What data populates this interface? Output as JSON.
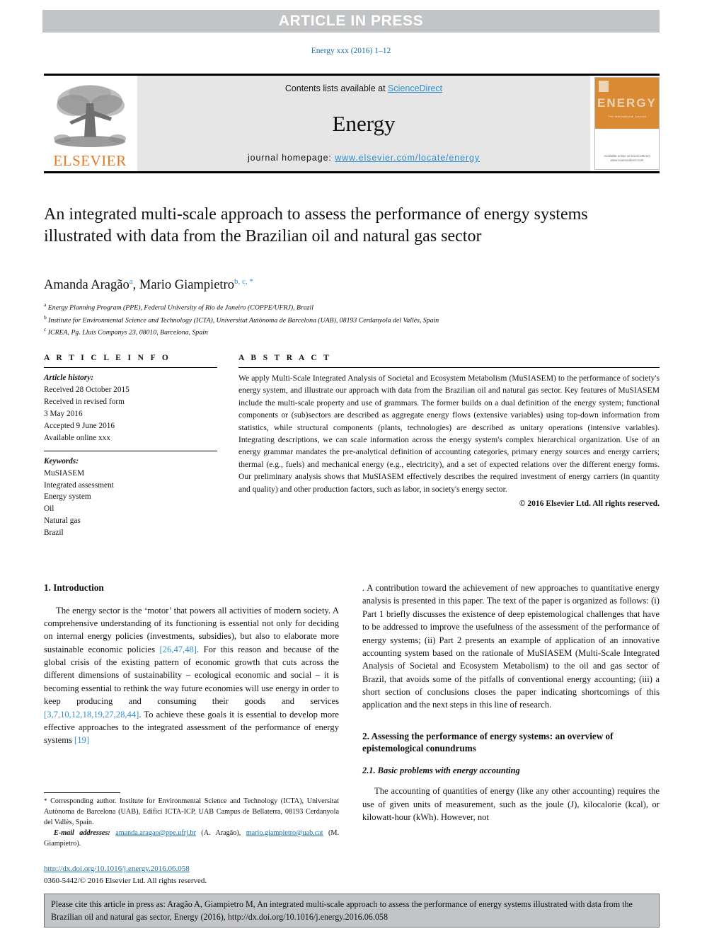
{
  "banner": {
    "label": "ARTICLE IN PRESS"
  },
  "running_head": "Energy xxx (2016) 1–12",
  "masthead": {
    "contents_prefix": "Contents lists available at ",
    "sciencedirect": "ScienceDirect",
    "journal_name": "Energy",
    "homepage_prefix": "journal homepage: ",
    "homepage_url": "www.elsevier.com/locate/energy",
    "publisher_logo_text": "ELSEVIER",
    "cover": {
      "title": "ENERGY",
      "subtitle": "The International Journal",
      "footer": "Available online at\nScienceDirect\nwww.sciencedirect.com"
    },
    "accent_link_color": "#2e8fd0",
    "elsevier_orange": "#e87722"
  },
  "article": {
    "title": "An integrated multi-scale approach to assess the performance of energy systems illustrated with data from the Brazilian oil and natural gas sector",
    "authors": [
      {
        "name": "Amanda Aragão",
        "marks": "a"
      },
      {
        "name": "Mario Giampietro",
        "marks": "b, c, *"
      }
    ],
    "affiliations": [
      {
        "mark": "a",
        "text": "Energy Planning Program (PPE), Federal University of Rio de Janeiro (COPPE/UFRJ), Brazil"
      },
      {
        "mark": "b",
        "text": "Institute for Environmental Science and Technology (ICTA), Universitat Autònoma de Barcelona (UAB), 08193 Cerdanyola del Vallès, Spain"
      },
      {
        "mark": "c",
        "text": "ICREA, Pg. Lluís Companys 23, 08010, Barcelona, Spain"
      }
    ]
  },
  "article_info": {
    "heading": "A R T I C L E  I N F O",
    "history_label": "Article history:",
    "history_lines": [
      "Received 28 October 2015",
      "Received in revised form",
      "3 May 2016",
      "Accepted 9 June 2016",
      "Available online xxx"
    ],
    "keywords_label": "Keywords:",
    "keywords": [
      "MuSIASEM",
      "Integrated assessment",
      "Energy system",
      "Oil",
      "Natural gas",
      "Brazil"
    ]
  },
  "abstract": {
    "heading": "A B S T R A C T",
    "text": "We apply Multi-Scale Integrated Analysis of Societal and Ecosystem Metabolism (MuSIASEM) to the performance of society's energy system, and illustrate our approach with data from the Brazilian oil and natural gas sector. Key features of MuSIASEM include the multi-scale property and use of grammars. The former builds on a dual definition of the energy system; functional components or (sub)sectors are described as aggregate energy flows (extensive variables) using top-down information from statistics, while structural components (plants, technologies) are described as unitary operations (intensive variables). Integrating descriptions, we can scale information across the energy system's complex hierarchical organization. Use of an energy grammar mandates the pre-analytical definition of accounting categories, primary energy sources and energy carriers; thermal (e.g., fuels) and mechanical energy (e.g., electricity), and a set of expected relations over the different energy forms. Our preliminary analysis shows that MuSIASEM effectively describes the required investment of energy carriers (in quantity and quality) and other production factors, such as labor, in society's energy sector.",
    "copyright": "© 2016 Elsevier Ltd. All rights reserved."
  },
  "body": {
    "section1_heading": "1. Introduction",
    "p1_a": "The energy sector is the ‘motor’ that powers all activities of modern society. A comprehensive understanding of its functioning is essential not only for deciding on internal energy policies (investments, subsidies), but also to elaborate more sustainable economic policies ",
    "p1_ref1": "[26,47,48]",
    "p1_b": ". For this reason and because of the global crisis of the existing pattern of economic growth that cuts across the different dimensions of sustainability – ecological economic and social – it is becoming essential to rethink the way future economies will use energy in order to keep producing and consuming their goods and services ",
    "p1_ref2": "[3,7,10,12,18,19,27,28,44]",
    "p1_c": ". To achieve these goals it is essential to develop more effective approaches to the integrated assessment of the performance of energy systems ",
    "p1_ref3": "[19]",
    "p1_d": ". A contribution toward the achievement of new approaches to quantitative energy analysis is presented in this paper. The text of the paper is organized as follows: (i) Part 1 briefly discusses the existence of deep epistemological challenges that have to be addressed to improve the usefulness of the assessment of the performance of energy systems; (ii) Part 2 presents an example of application of an innovative accounting system based on the rationale of MuSIASEM (Multi-Scale Integrated Analysis of Societal and Ecosystem Metabolism) to the oil and gas sector of Brazil, that avoids some of the pitfalls of conventional energy accounting; (iii) a short section of conclusions closes the paper indicating shortcomings of this application and the next steps in this line of research.",
    "section2_heading": "2. Assessing the performance of energy systems: an overview of epistemological conundrums",
    "section21_heading": "2.1. Basic problems with energy accounting",
    "p2": "The accounting of quantities of energy (like any other accounting) requires the use of given units of measurement, such as the joule (J), kilocalorie (kcal), or kilowatt-hour (kWh). However, not"
  },
  "footnotes": {
    "corresponding_mark": "*",
    "corresponding_text": " Corresponding author. Institute for Environmental Science and Technology (ICTA), Universitat Autònoma de Barcelona (UAB), Edifici ICTA-ICP, UAB Campus de Bellaterra, 08193 Cerdanyola del Vallès, Spain.",
    "email_label": "E-mail addresses:",
    "email1": "amanda.aragao@ppe.ufrj.br",
    "email1_who": " (A. Aragão), ",
    "email2": "mario.giampietro@uab.cat",
    "email2_who": " (M. Giampietro).",
    "doi_url": "http://dx.doi.org/10.1016/j.energy.2016.06.058",
    "issn_line": "0360-5442/© 2016 Elsevier Ltd. All rights reserved."
  },
  "cite_box": {
    "text": "Please cite this article in press as: Aragão A, Giampietro M, An integrated multi-scale approach to assess the performance of energy systems illustrated with data from the Brazilian oil and natural gas sector, Energy (2016), http://dx.doi.org/10.1016/j.energy.2016.06.058"
  }
}
